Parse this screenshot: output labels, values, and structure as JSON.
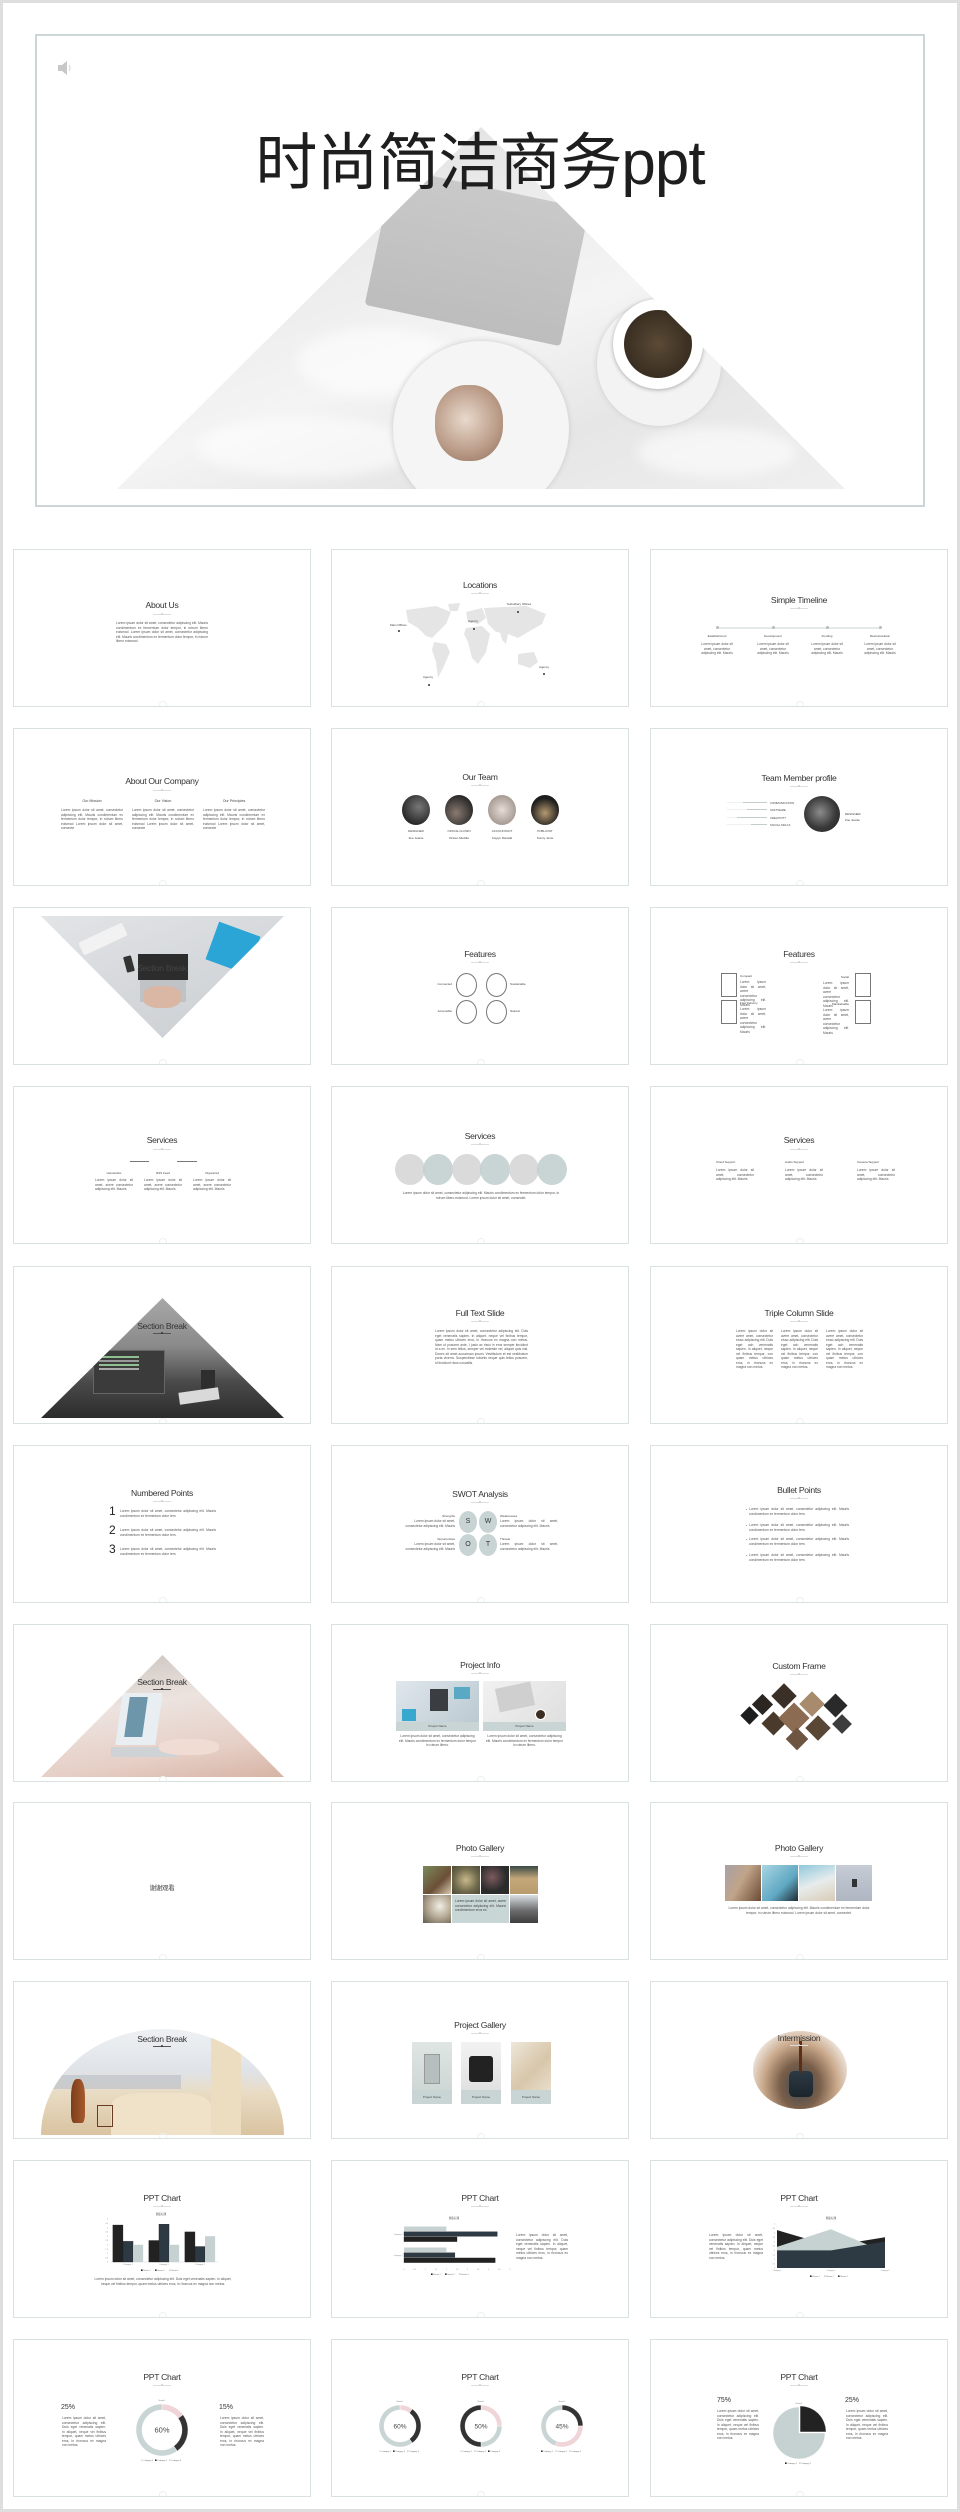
{
  "theme": {
    "dark": "#222222",
    "slate": "#2e3a43",
    "light": "#c6d1d1",
    "pink": "#efd5d8",
    "frame": "#d9e1e1",
    "map": "#e5e5e5"
  },
  "title_slide": {
    "title": "时尚简洁商务ppt",
    "audio_icon": "speaker-icon"
  },
  "lorem": {
    "short": "Lorem ipsum dolor sit amet, consectetur adipiscing elit. Mauris",
    "line": "Lorem ipsum dolor sit amet, consectetur adipiscing elit. Mauris condimentum ex fermentum dolor tem.",
    "avere": "Lorem ipsum dolor sit amet, avere consectetur adipiscing elit. Mauris",
    "medium": "Lorem ipsum dolor sit amet, consectetur adipiscing elit. Mauris condimentum ex fermentum dolor tempor, in rutrum libero euismod. Lorem ipsum dolor sit amet, consectet.",
    "para": "Lorem ipsum dolor sit amet, consectetur adipiscing elit. Duis eget venenatis sapien. In aliquet, neque vel finibus tempor, quam metus ultrices eros, in rhoncus ex magna non metus.",
    "long": "Lorem ipsum dolor sit amet, consectetur adipiscing elit. Duis eget venenatis sapien. In aliquet, neque vel finibus tempor, quam metus ultrices eros, in rhoncus ex magna non metus. Nam ut posuere ante, I justo ac risus in eros semper tincidunt id a ex. In sem tellus, semper vel molestie vel, aliquet quis nisl. Donec sit amet accumsan ipsum. Vestibulum et est vestibulum porta viverra. Suspendisse lobortis neque quis tellus posuere, id tincidunt risus convallis.",
    "column": "Lorem ipsum dolor sit avere amet, consectetur eiusc adipiscing elit. Duis eget ach venenatis sapien. In aliquet, neque vel finibus tempor, con quam metus ultrices eros, in rhoncus ex magna non metus.",
    "about": "Lorem ipsum dolor sit amet, consectetur adipiscing elit. Mauris condimentum ex fermentum dolor tempor, in rutrum libero euismod. Lorem ipsum dolor sit amet, consectetur adipiscing elit. Mauris condimentum ex fermentum dolor tempor, in rutrum libero euismod.",
    "company": "Lorem ipsum dolor sit amet, consectetur adipiscing elit. Mauris condimentum ex fermentum dolor tempor, in rutrum libero euismod Lorem ipsum dolor sit amet, consecte",
    "gallery": "Lorem ipsum dolor sit amet, avere consectetur adipiscing elit. Mauris condimentum eros ex.",
    "card": "Lorem ipsum dolor sit amet, consectetur adipiscing elit. Mauris condimentum ex fermentum dolor tempor in rutrum libero."
  },
  "slides": {
    "about_us": {
      "title": "About Us"
    },
    "locations": {
      "title": "Locations",
      "pins": [
        "Main Offices",
        "Agency",
        "Subsidiary Offices",
        "Agency",
        "Agency"
      ]
    },
    "timeline": {
      "title": "Simple Timeline",
      "steps": [
        "Establishment",
        "Development",
        "Funding",
        "Restructuration"
      ]
    },
    "company": {
      "title": "About Our Company",
      "columns": [
        "Our Mission",
        "Our Vision",
        "Our Principles"
      ]
    },
    "team": {
      "title": "Our Team",
      "members": [
        {
          "role": "DESIGNER",
          "name": "Zoe Jeanie"
        },
        {
          "role": "OFFICE CLOWN",
          "name": "Kirsten Meddle"
        },
        {
          "role": "ACCOUNTANT",
          "name": "Kaylyn Randall"
        },
        {
          "role": "PUBLICIST",
          "name": "Sunny Jenie"
        }
      ]
    },
    "profile": {
      "title": "Team Member profile",
      "role": "DESIGNER",
      "name": "Zoe Jeanie",
      "skills": [
        {
          "label": "COMMUNICATION",
          "level": 0.6
        },
        {
          "label": "SOFTWARE",
          "level": 0.5
        },
        {
          "label": "CREATIVITY",
          "level": 0.75
        },
        {
          "label": "SOCIAL SKILLS",
          "level": 0.4
        }
      ]
    },
    "section": {
      "title": "Section Break"
    },
    "features1": {
      "title": "Features",
      "items": [
        "Connected",
        "Sustainable",
        "Accessible",
        "Natural"
      ]
    },
    "features2": {
      "title": "Features",
      "items": [
        "Compact",
        "Social",
        "Fast Delivery",
        "Maintainable"
      ]
    },
    "services1": {
      "title": "Services",
      "items": [
        "Humanistic",
        "RSS Feed",
        "Organized"
      ]
    },
    "services2": {
      "title": "Services"
    },
    "services3": {
      "title": "Services",
      "items": [
        "Cloud Support",
        "Audio Support",
        "Camera Support"
      ]
    },
    "full_text": {
      "title": "Full Text Slide"
    },
    "triple": {
      "title": "Triple Column Slide"
    },
    "numbered": {
      "title": "Numbered Points",
      "numbers": [
        "1",
        "2",
        "3"
      ]
    },
    "swot": {
      "title": "SWOT Analysis",
      "letters": [
        "S",
        "W",
        "O",
        "T"
      ],
      "headings": [
        "Strengths",
        "Weaknesses",
        "Opportunities",
        "Threats"
      ]
    },
    "bullets": {
      "title": "Bullet Points"
    },
    "project_info": {
      "title": "Project Info",
      "caption": "Project Name"
    },
    "custom_frame": {
      "title": "Custom Frame"
    },
    "thanks": {
      "text": "谢谢观看"
    },
    "gallery1": {
      "title": "Photo Gallery"
    },
    "gallery2": {
      "title": "Photo Gallery"
    },
    "project_gallery": {
      "title": "Project Gallery",
      "caption": "Project Name"
    },
    "intermission": {
      "title": "Intermission"
    },
    "chart": {
      "title": "PPT Chart"
    },
    "chart4": {
      "left_value": "25%",
      "right_value": "15%"
    },
    "chart6": {
      "left_value": "75%",
      "right_value": "25%"
    }
  },
  "chart_data": [
    {
      "type": "bar",
      "title": "图表标题",
      "categories": [
        "Category 1",
        "Category 2",
        "Category 3"
      ],
      "series": [
        {
          "name": "Series 1",
          "values": [
            4.3,
            2.5,
            3.5
          ],
          "color": "#222222"
        },
        {
          "name": "Series 2",
          "values": [
            2.4,
            4.4,
            1.8
          ],
          "color": "#2e3a43"
        },
        {
          "name": "Series 3",
          "values": [
            2,
            2,
            3
          ],
          "color": "#c6d1d1"
        }
      ],
      "ylim": [
        0,
        5
      ],
      "tick_step": 0.5,
      "legend": "bottom",
      "grid": false
    },
    {
      "type": "bar",
      "orientation": "horizontal",
      "title": "图表标题",
      "categories": [
        "Category 1",
        "Category 2"
      ],
      "series": [
        {
          "name": "Series 1",
          "values": [
            4.3,
            2.5
          ],
          "color": "#222222"
        },
        {
          "name": "Series 2",
          "values": [
            2.4,
            4.4
          ],
          "color": "#2e3a43"
        },
        {
          "name": "Series 3",
          "values": [
            2,
            2
          ],
          "color": "#c6d1d1"
        }
      ],
      "xlim": [
        0,
        5
      ],
      "tick_step": 0.5,
      "legend": "bottom",
      "grid": false
    },
    {
      "type": "area",
      "title": "图表标题",
      "categories": [
        "Category 1",
        "Category 2",
        "Category 3"
      ],
      "series": [
        {
          "name": "Series 1",
          "values": [
            4.3,
            2.5,
            3.5
          ],
          "color": "#222222"
        },
        {
          "name": "Series 2",
          "values": [
            2.4,
            4.4,
            1.8
          ],
          "color": "#c6d1d1"
        },
        {
          "name": "Series 3",
          "values": [
            2,
            2,
            3
          ],
          "color": "#2e3a43"
        }
      ],
      "ylim": [
        0,
        5
      ],
      "tick_step": 0.5,
      "legend": "bottom",
      "grid": false
    },
    {
      "type": "pie",
      "donut": true,
      "series_name": "Series 1",
      "center_label": "60%",
      "slices": [
        {
          "category": "Category 1",
          "value": 15,
          "color": "#efd5d8"
        },
        {
          "category": "Category 2",
          "value": 25,
          "color": "#333333"
        },
        {
          "category": "Category 3",
          "value": 60,
          "color": "#c9d4d4"
        }
      ],
      "legend": "bottom"
    },
    {
      "type": "pie",
      "donut": true,
      "multiple": [
        {
          "series_name": "Series 1",
          "center_label": "60%",
          "slices": [
            {
              "category": "Category 1",
              "value": 10,
              "color": "#efd5d8"
            },
            {
              "category": "Category 2",
              "value": 30,
              "color": "#333333"
            },
            {
              "category": "Category 3",
              "value": 60,
              "color": "#c9d4d4"
            }
          ]
        },
        {
          "series_name": "Series 1",
          "center_label": "50%",
          "slices": [
            {
              "category": "Category 1",
              "value": 25,
              "color": "#efd5d8"
            },
            {
              "category": "Category 2",
              "value": 25,
              "color": "#c9d4d4"
            },
            {
              "category": "Category 3",
              "value": 50,
              "color": "#333333"
            }
          ]
        },
        {
          "series_name": "Series 1",
          "center_label": "45%",
          "slices": [
            {
              "category": "Category 1",
              "value": 25,
              "color": "#333333"
            },
            {
              "category": "Category 2",
              "value": 30,
              "color": "#efd5d8"
            },
            {
              "category": "Category 3",
              "value": 45,
              "color": "#c9d4d4"
            }
          ]
        }
      ],
      "legend": "bottom"
    },
    {
      "type": "pie",
      "series_name": "Series 1",
      "slices": [
        {
          "category": "Category 1",
          "value": 25,
          "color": "#222222",
          "exploded": true
        },
        {
          "category": "Category 2",
          "value": 75,
          "color": "#c6d1d1"
        }
      ],
      "legend": "bottom"
    }
  ]
}
